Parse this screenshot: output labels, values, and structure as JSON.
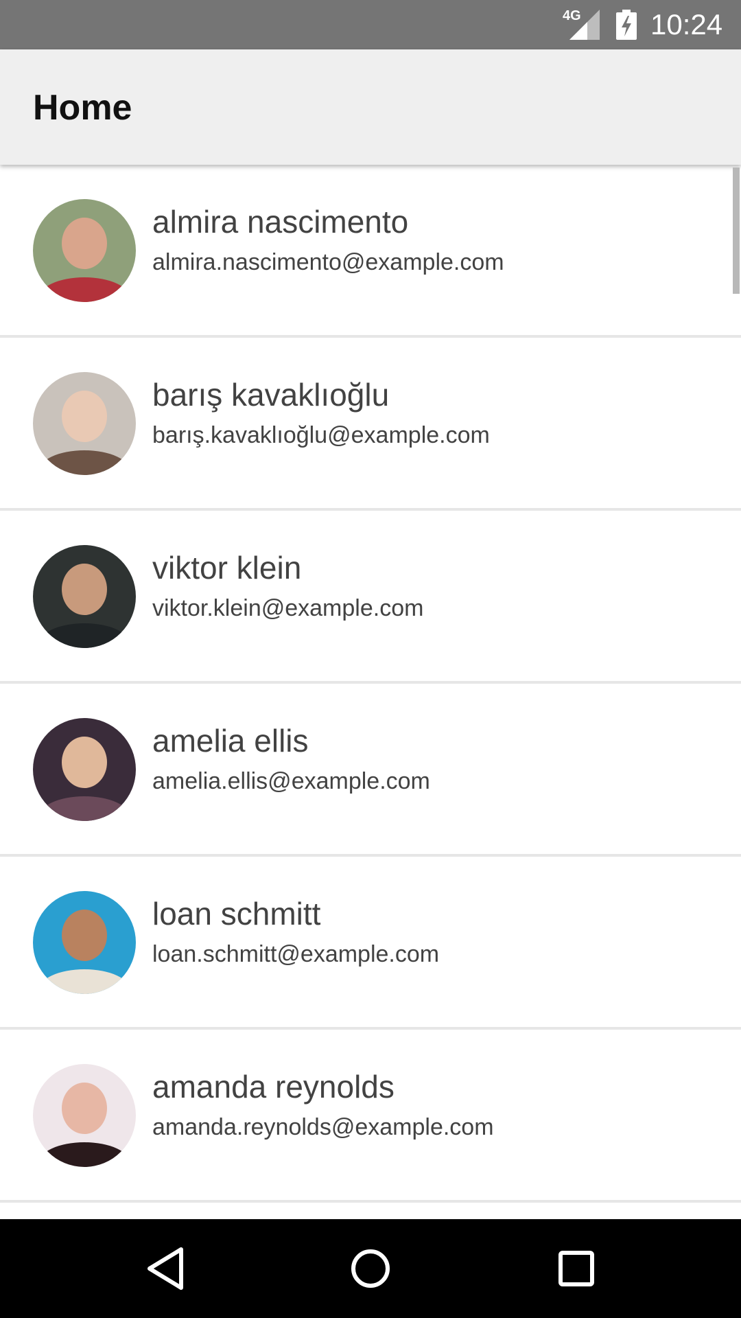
{
  "status_bar": {
    "network": "4G",
    "time": "10:24",
    "signal_icon": "cell-signal-icon",
    "battery_icon": "battery-charging-icon"
  },
  "app_bar": {
    "title": "Home"
  },
  "contacts": [
    {
      "name": "almira nascimento",
      "email": "almira.nascimento@example.com",
      "avatar": {
        "bg": "#8fa07a",
        "face": "#d9a58c",
        "body": "#b3323b"
      }
    },
    {
      "name": "barış kavaklıoğlu",
      "email": "barış.kavaklıoğlu@example.com",
      "avatar": {
        "bg": "#c9c2bb",
        "face": "#e9c9b4",
        "body": "#6d5446"
      }
    },
    {
      "name": "viktor klein",
      "email": "viktor.klein@example.com",
      "avatar": {
        "bg": "#2e3332",
        "face": "#c89a7c",
        "body": "#1f2426"
      }
    },
    {
      "name": "amelia ellis",
      "email": "amelia.ellis@example.com",
      "avatar": {
        "bg": "#3a2c3a",
        "face": "#e0b89a",
        "body": "#6b4a5a"
      }
    },
    {
      "name": "loan schmitt",
      "email": "loan.schmitt@example.com",
      "avatar": {
        "bg": "#2a9fd0",
        "face": "#b9825f",
        "body": "#e9e2d6"
      }
    },
    {
      "name": "amanda reynolds",
      "email": "amanda.reynolds@example.com",
      "avatar": {
        "bg": "#efe6ea",
        "face": "#e7b7a5",
        "body": "#2a1a1c"
      }
    }
  ],
  "nav_bar": {
    "back_icon": "back-triangle-icon",
    "home_icon": "home-circle-icon",
    "recents_icon": "recents-square-icon"
  }
}
